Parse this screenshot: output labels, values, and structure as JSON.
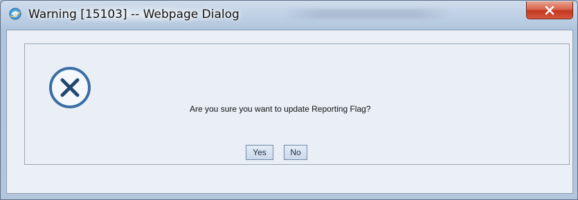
{
  "window": {
    "title": "Warning [15103] -- Webpage Dialog"
  },
  "dialog": {
    "message": "Are you sure you want to update Reporting Flag?",
    "buttons": {
      "yes_label": "Yes",
      "no_label": "No"
    },
    "icon": "error-x-icon"
  },
  "colors": {
    "close_button": "#c4361f",
    "icon_blue": "#3a6ea5",
    "panel_background": "#e9eff5"
  }
}
